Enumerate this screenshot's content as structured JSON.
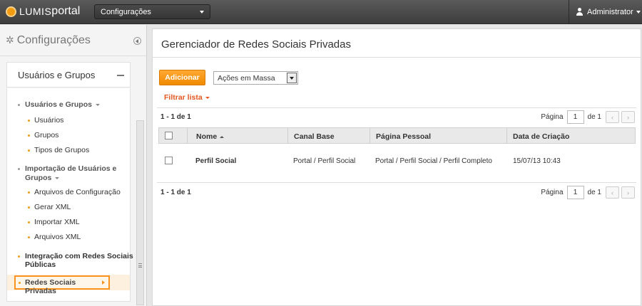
{
  "topbar": {
    "logo_lumis": "LUMIS",
    "logo_portal": "portal",
    "context_select": "Configurações",
    "user": "Administrator"
  },
  "sidebar": {
    "title": "Configurações",
    "group": "Usuários e Grupos",
    "items": [
      {
        "label": "Usuários e Grupos",
        "type": "section"
      },
      {
        "label": "Usuários",
        "type": "item"
      },
      {
        "label": "Grupos",
        "type": "item"
      },
      {
        "label": "Tipos de Grupos",
        "type": "item"
      },
      {
        "label": "Importação de Usuários e",
        "type": "section"
      },
      {
        "label": "Grupos",
        "type": "section-cont"
      },
      {
        "label": "Arquivos de Configuração",
        "type": "item"
      },
      {
        "label": "Gerar XML",
        "type": "item"
      },
      {
        "label": "Importar XML",
        "type": "item"
      },
      {
        "label": "Arquivos XML",
        "type": "item"
      },
      {
        "label": "Integração com Redes Sociais",
        "type": "section"
      },
      {
        "label": "Públicas",
        "type": "section-cont"
      },
      {
        "label": "Redes Sociais Privadas",
        "type": "active"
      }
    ]
  },
  "main": {
    "title": "Gerenciador de Redes Sociais Privadas",
    "add_button": "Adicionar",
    "bulk_actions": "Ações em Massa",
    "filter": "Filtrar lista",
    "count_top": "1 - 1 de 1",
    "count_bottom": "1 - 1 de 1",
    "pager": {
      "page_label": "Página",
      "page_value": "1",
      "of_label": "de 1"
    },
    "columns": [
      "Nome",
      "Canal Base",
      "Página Pessoal",
      "Data de Criação"
    ],
    "rows": [
      {
        "nome": "Perfil Social",
        "canal": "Portal / Perfil Social",
        "pagina": "Portal / Perfil Social / Perfil Completo",
        "data": "15/07/13 10:43"
      }
    ]
  },
  "colors": {
    "accent": "#f7931e",
    "link": "#e4561f",
    "topbar": "#4a4a4a"
  }
}
